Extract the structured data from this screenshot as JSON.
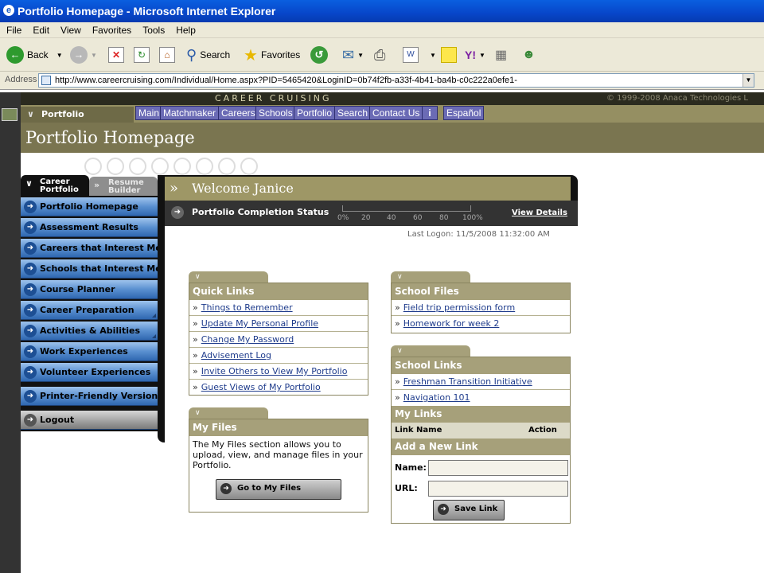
{
  "window": {
    "title": "Portfolio Homepage - Microsoft Internet Explorer"
  },
  "menubar": [
    "File",
    "Edit",
    "View",
    "Favorites",
    "Tools",
    "Help"
  ],
  "toolbar": {
    "back_label": "Back",
    "search_label": "Search",
    "favorites_label": "Favorites"
  },
  "address": {
    "label": "Address",
    "url": "http://www.careercruising.com/Individual/Home.aspx?PID=5465420&LoginID=0b74f2fb-a33f-4b41-ba4b-c0c222a0efe1-"
  },
  "site": {
    "brand": "CAREER CRUISING",
    "copyright": "© 1999-2008 Anaca Technologies L",
    "section_tab": "Portfolio",
    "nav": [
      "Main",
      "Matchmaker",
      "Careers",
      "Schools",
      "Portfolio",
      "Search",
      "Contact Us"
    ],
    "info_icon": "i",
    "language": "Español",
    "page_title": "Portfolio Homepage"
  },
  "left_tabs": {
    "career_line1": "Career",
    "career_line2": "Portfolio",
    "resume_line1": "Resume",
    "resume_line2": "Builder"
  },
  "left_nav": [
    "Portfolio Homepage",
    "Assessment Results",
    "Careers that Interest Me",
    "Schools that Interest Me",
    "Course Planner",
    "Career Preparation",
    "Activities & Abilities",
    "Work Experiences",
    "Volunteer Experiences",
    "Printer-Friendly Version",
    "Logout"
  ],
  "welcome": {
    "text": "Welcome Janice"
  },
  "status": {
    "label": "Portfolio Completion Status",
    "progress_percent": 0,
    "ticks": [
      "0%",
      "20",
      "40",
      "60",
      "80",
      "100%"
    ],
    "view_details": "View Details",
    "last_logon": "Last Logon: 11/5/2008 11:32:00 AM"
  },
  "quick_links": {
    "title": "Quick Links",
    "items": [
      "Things to Remember",
      "Update My Personal Profile",
      "Change My Password",
      "Advisement Log",
      "Invite Others to View My Portfolio",
      "Guest Views of My Portfolio"
    ]
  },
  "my_files": {
    "title": "My Files",
    "description": "The My Files section allows you to upload, view, and manage files in your Portfolio.",
    "button": "Go to My Files"
  },
  "school_files": {
    "title": "School Files",
    "items": [
      "Field trip permission form",
      "Homework for week 2"
    ]
  },
  "school_links": {
    "title": "School Links",
    "items": [
      "Freshman Transition Initiative",
      "Navigation 101"
    ]
  },
  "my_links": {
    "title": "My Links",
    "col_name": "Link Name",
    "col_action": "Action",
    "add_title": "Add a New Link",
    "name_label": "Name:",
    "url_label": "URL:",
    "name_value": "",
    "url_value": "",
    "save_button": "Save Link"
  }
}
